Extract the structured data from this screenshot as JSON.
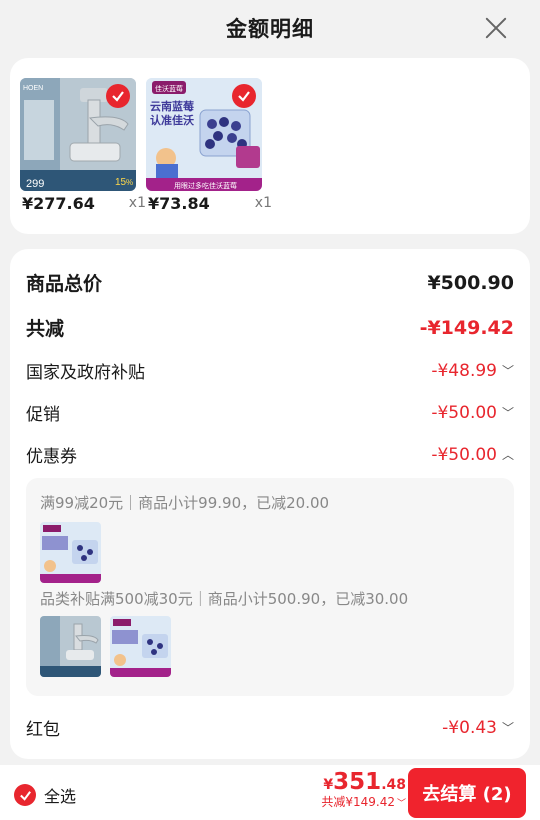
{
  "header": {
    "title": "金额明细"
  },
  "products": [
    {
      "price": "¥277.64",
      "qty": "x1",
      "thumb_icon": "faucet-image",
      "thumb_text": "HOEN",
      "thumb_badge": "299",
      "thumb_pct": "15"
    },
    {
      "price": "¥73.84",
      "qty": "x1",
      "thumb_icon": "blueberry-image",
      "thumb_text": "云南蓝莓",
      "thumb_text2": "认准佳沃",
      "thumb_brand": "佳沃蓝莓",
      "thumb_slogan": "用眼过多吃佳沃蓝莓"
    }
  ],
  "summary": {
    "goods_total_label": "商品总价",
    "goods_total_value": "¥500.90",
    "discount_label": "共减",
    "discount_value": "-¥149.42",
    "subsidy_label": "国家及政府补贴",
    "subsidy_value": "-¥48.99",
    "promo_label": "促销",
    "promo_value": "-¥50.00",
    "coupon_label": "优惠券",
    "coupon_value": "-¥50.00",
    "redpacket_label": "红包",
    "redpacket_value": "-¥0.43"
  },
  "coupons": {
    "line1": "满99减20元｜商品小计99.90，已减20.00",
    "line2": "品类补贴满500减30元｜商品小计500.90，已减30.00"
  },
  "bottom": {
    "select_all": "全选",
    "currency": "¥",
    "amount_int": "351",
    "amount_dec": ".48",
    "total_discount": "共减¥149.42",
    "checkout": "去结算 (2)"
  },
  "colors": {
    "accent": "#e8262e",
    "background": "#f2f2f2"
  }
}
